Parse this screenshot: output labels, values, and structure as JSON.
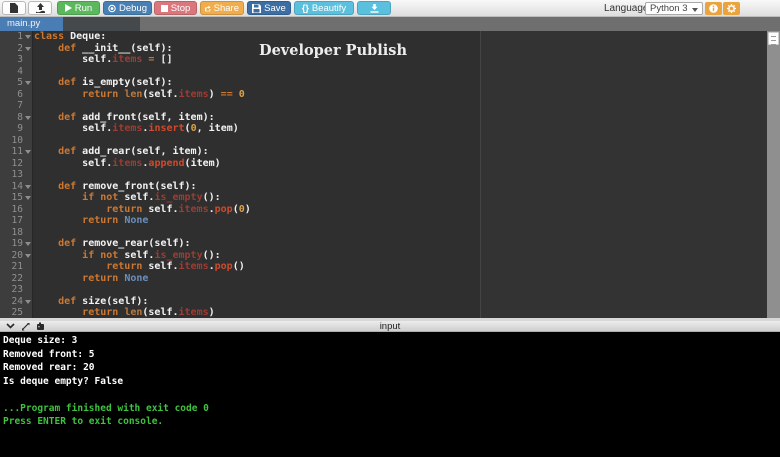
{
  "colors": {
    "run_button": "#5cb85c",
    "debug_button": "#4880b4",
    "stop_button": "#d9777d",
    "share_button": "#f0ad4e",
    "save_button": "#3a6ea5",
    "beautify_button": "#5bc0de",
    "utility_button": "#e9a440",
    "active_tab": "#4a7db4",
    "editor_background": "#2f2f2f",
    "keyword": "#cc7832",
    "property": "#9e3c31",
    "method_call": "#cf4a2c",
    "builtin": "#b8793f",
    "number": "#dca24a",
    "constant": "#6a8fbb",
    "console_background": "#000000",
    "console_text": "#ffffff",
    "console_system_text": "#3fc23f"
  },
  "icons": [
    "new-file-icon",
    "upload-icon",
    "play-icon",
    "debug-record-icon",
    "stop-square-icon",
    "share-icon",
    "save-floppy-icon",
    "braces-icon",
    "download-icon",
    "info-icon",
    "gear-icon",
    "select-caret-icon",
    "chevron-down-icon",
    "expand-icon",
    "console-keyboard-icon",
    "fold-arrow-icon"
  ],
  "toolbar": {
    "run": "Run",
    "debug": "Debug",
    "stop": "Stop",
    "share": "Share",
    "save": "Save",
    "beautify_icon": "{}",
    "beautify": "Beautify",
    "language_label": "Language",
    "language_value": "Python 3"
  },
  "tabbar": {
    "active_tab": "main.py"
  },
  "editor": {
    "watermark": "Developer Publish",
    "lines": [
      {
        "n": 1,
        "fold": true,
        "t": [
          [
            "k",
            "class"
          ],
          [
            "w",
            " Deque:"
          ]
        ]
      },
      {
        "n": 2,
        "fold": true,
        "t": [
          [
            "w",
            "    "
          ],
          [
            "k",
            "def"
          ],
          [
            "w",
            " __init__(self):"
          ]
        ]
      },
      {
        "n": 3,
        "fold": false,
        "t": [
          [
            "w",
            "        self."
          ],
          [
            "p",
            "items"
          ],
          [
            "w",
            " "
          ],
          [
            "o",
            "="
          ],
          [
            "w",
            " []"
          ]
        ]
      },
      {
        "n": 4,
        "fold": false,
        "t": []
      },
      {
        "n": 5,
        "fold": true,
        "t": [
          [
            "w",
            "    "
          ],
          [
            "k",
            "def"
          ],
          [
            "w",
            " is_empty(self):"
          ]
        ]
      },
      {
        "n": 6,
        "fold": false,
        "t": [
          [
            "w",
            "        "
          ],
          [
            "k",
            "return"
          ],
          [
            "w",
            " "
          ],
          [
            "b",
            "len"
          ],
          [
            "w",
            "(self."
          ],
          [
            "p",
            "items"
          ],
          [
            "w",
            ") "
          ],
          [
            "o",
            "=="
          ],
          [
            "w",
            " "
          ],
          [
            "m",
            "0"
          ]
        ]
      },
      {
        "n": 7,
        "fold": false,
        "t": []
      },
      {
        "n": 8,
        "fold": true,
        "t": [
          [
            "w",
            "    "
          ],
          [
            "k",
            "def"
          ],
          [
            "w",
            " add_front(self, item):"
          ]
        ]
      },
      {
        "n": 9,
        "fold": false,
        "t": [
          [
            "w",
            "        self."
          ],
          [
            "p",
            "items"
          ],
          [
            "w",
            "."
          ],
          [
            "f",
            "insert"
          ],
          [
            "w",
            "("
          ],
          [
            "m",
            "0"
          ],
          [
            "w",
            ", item)"
          ]
        ]
      },
      {
        "n": 10,
        "fold": false,
        "t": []
      },
      {
        "n": 11,
        "fold": true,
        "t": [
          [
            "w",
            "    "
          ],
          [
            "k",
            "def"
          ],
          [
            "w",
            " add_rear(self, item):"
          ]
        ]
      },
      {
        "n": 12,
        "fold": false,
        "t": [
          [
            "w",
            "        self."
          ],
          [
            "p",
            "items"
          ],
          [
            "w",
            "."
          ],
          [
            "f",
            "append"
          ],
          [
            "w",
            "(item)"
          ]
        ]
      },
      {
        "n": 13,
        "fold": false,
        "t": []
      },
      {
        "n": 14,
        "fold": true,
        "t": [
          [
            "w",
            "    "
          ],
          [
            "k",
            "def"
          ],
          [
            "w",
            " remove_front(self):"
          ]
        ]
      },
      {
        "n": 15,
        "fold": true,
        "t": [
          [
            "w",
            "        "
          ],
          [
            "k",
            "if"
          ],
          [
            "w",
            " "
          ],
          [
            "k",
            "not"
          ],
          [
            "w",
            " self."
          ],
          [
            "p",
            "is_empty"
          ],
          [
            "w",
            "():"
          ]
        ]
      },
      {
        "n": 16,
        "fold": false,
        "t": [
          [
            "w",
            "            "
          ],
          [
            "k",
            "return"
          ],
          [
            "w",
            " self."
          ],
          [
            "p",
            "items"
          ],
          [
            "w",
            "."
          ],
          [
            "f",
            "pop"
          ],
          [
            "w",
            "("
          ],
          [
            "m",
            "0"
          ],
          [
            "w",
            ")"
          ]
        ]
      },
      {
        "n": 17,
        "fold": false,
        "t": [
          [
            "w",
            "        "
          ],
          [
            "k",
            "return"
          ],
          [
            "w",
            " "
          ],
          [
            "c",
            "None"
          ]
        ]
      },
      {
        "n": 18,
        "fold": false,
        "t": []
      },
      {
        "n": 19,
        "fold": true,
        "t": [
          [
            "w",
            "    "
          ],
          [
            "k",
            "def"
          ],
          [
            "w",
            " remove_rear(self):"
          ]
        ]
      },
      {
        "n": 20,
        "fold": true,
        "t": [
          [
            "w",
            "        "
          ],
          [
            "k",
            "if"
          ],
          [
            "w",
            " "
          ],
          [
            "k",
            "not"
          ],
          [
            "w",
            " self."
          ],
          [
            "p",
            "is_empty"
          ],
          [
            "w",
            "():"
          ]
        ]
      },
      {
        "n": 21,
        "fold": false,
        "t": [
          [
            "w",
            "            "
          ],
          [
            "k",
            "return"
          ],
          [
            "w",
            " self."
          ],
          [
            "p",
            "items"
          ],
          [
            "w",
            "."
          ],
          [
            "f",
            "pop"
          ],
          [
            "w",
            "()"
          ]
        ]
      },
      {
        "n": 22,
        "fold": false,
        "t": [
          [
            "w",
            "        "
          ],
          [
            "k",
            "return"
          ],
          [
            "w",
            " "
          ],
          [
            "c",
            "None"
          ]
        ]
      },
      {
        "n": 23,
        "fold": false,
        "t": []
      },
      {
        "n": 24,
        "fold": true,
        "t": [
          [
            "w",
            "    "
          ],
          [
            "k",
            "def"
          ],
          [
            "w",
            " size(self):"
          ]
        ]
      },
      {
        "n": 25,
        "fold": false,
        "t": [
          [
            "w",
            "        "
          ],
          [
            "k",
            "return"
          ],
          [
            "w",
            " "
          ],
          [
            "b",
            "len"
          ],
          [
            "w",
            "(self."
          ],
          [
            "p",
            "items"
          ],
          [
            "w",
            ")"
          ]
        ]
      }
    ]
  },
  "console": {
    "header_label": "input",
    "output_lines": [
      {
        "text": "Deque size: 3",
        "type": "stdout"
      },
      {
        "text": "Removed front: 5",
        "type": "stdout"
      },
      {
        "text": "Removed rear: 20",
        "type": "stdout"
      },
      {
        "text": "Is deque empty? False",
        "type": "stdout"
      },
      {
        "text": "",
        "type": "stdout"
      },
      {
        "text": "...Program finished with exit code 0",
        "type": "system"
      },
      {
        "text": "Press ENTER to exit console.",
        "type": "system"
      }
    ]
  }
}
